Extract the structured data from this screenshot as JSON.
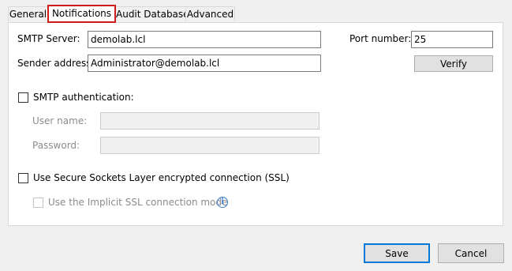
{
  "tabs": [
    {
      "label": "General",
      "active": false
    },
    {
      "label": "Notifications",
      "active": true
    },
    {
      "label": "Audit Database",
      "active": false
    },
    {
      "label": "Advanced",
      "active": false
    }
  ],
  "form": {
    "smtp_server_label": "SMTP Server:",
    "smtp_server_value": "demolab.lcl",
    "port_label": "Port number:",
    "port_value": "25",
    "sender_label": "Sender address:",
    "sender_value": "Administrator@demolab.lcl",
    "verify_label": "Verify",
    "smtp_auth_label": "SMTP authentication:",
    "smtp_auth_checked": false,
    "username_label": "User name:",
    "username_value": "",
    "password_label": "Password:",
    "password_value": "",
    "ssl_label": "Use Secure Sockets Layer encrypted connection (SSL)",
    "ssl_checked": false,
    "implicit_ssl_label": "Use the Implicit SSL connection mode",
    "implicit_ssl_checked": false,
    "info_icon": "info-icon"
  },
  "footer": {
    "save_label": "Save",
    "cancel_label": "Cancel"
  },
  "colors": {
    "active_tab_outline": "#d01b1b",
    "default_button_border": "#0078d7",
    "info_icon": "#3a7fd0"
  }
}
